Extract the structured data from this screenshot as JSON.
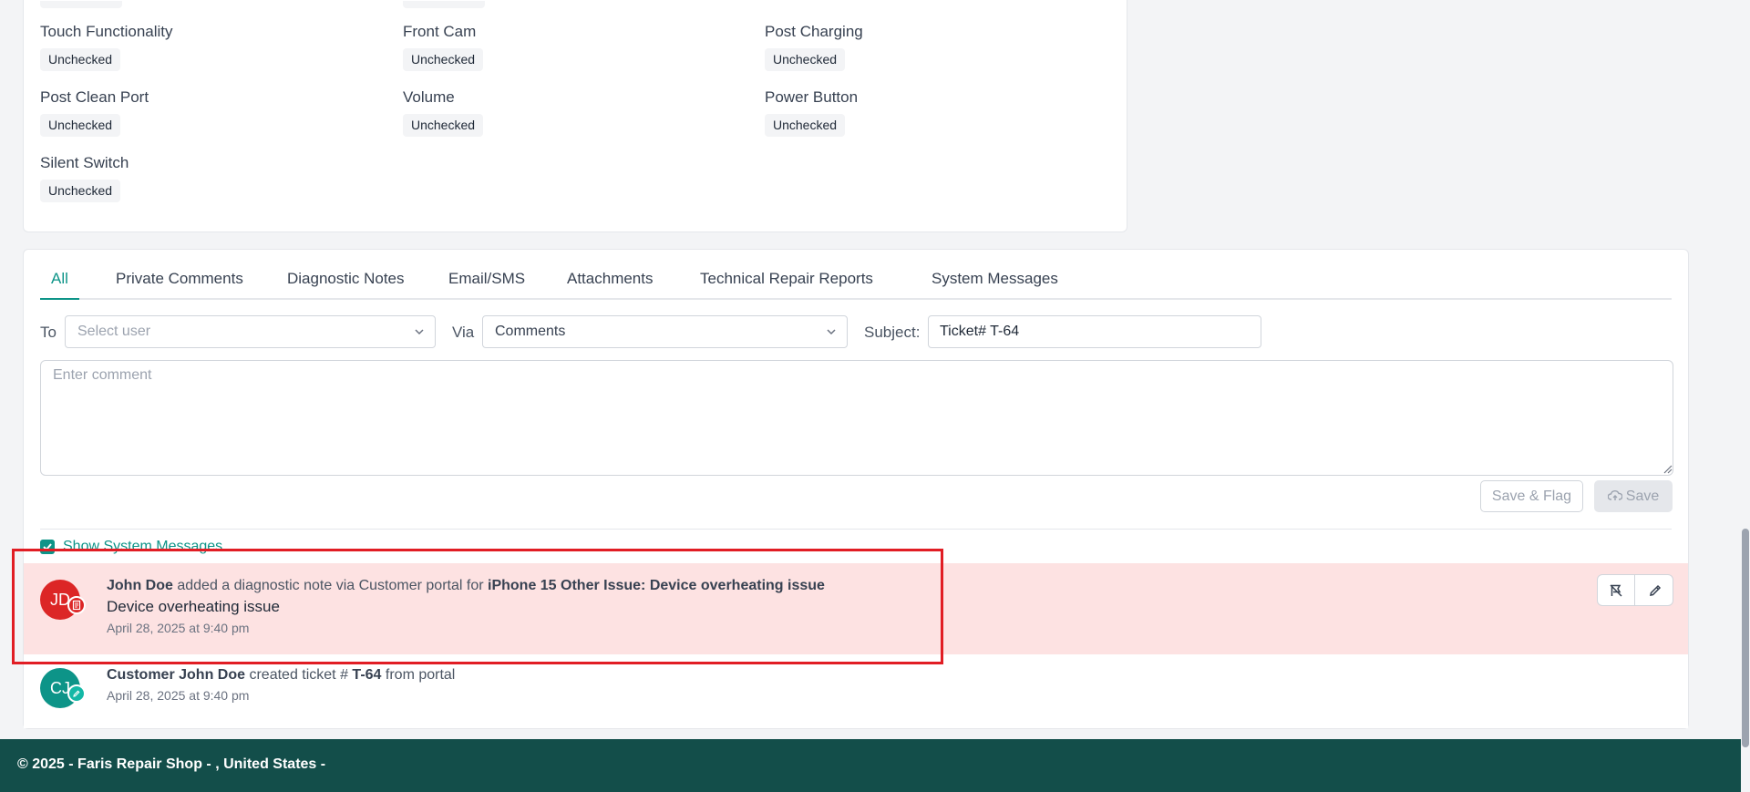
{
  "checklist": [
    {
      "label": "Touch Functionality",
      "status": "Unchecked"
    },
    {
      "label": "Front Cam",
      "status": "Unchecked"
    },
    {
      "label": "Post Charging",
      "status": "Unchecked"
    },
    {
      "label": "Post Clean Port",
      "status": "Unchecked"
    },
    {
      "label": "Volume",
      "status": "Unchecked"
    },
    {
      "label": "Power Button",
      "status": "Unchecked"
    },
    {
      "label": "Silent Switch",
      "status": "Unchecked"
    }
  ],
  "tabs": [
    "All",
    "Private Comments",
    "Diagnostic Notes",
    "Email/SMS",
    "Attachments",
    "Technical Repair Reports",
    "System Messages"
  ],
  "composer": {
    "to_label": "To",
    "to_placeholder": "Select user",
    "via_label": "Via",
    "via_value": "Comments",
    "subject_label": "Subject:",
    "subject_value": "Ticket# T-64",
    "comment_placeholder": "Enter comment",
    "save_flag_label": "Save & Flag",
    "save_label": "Save"
  },
  "show_system_messages": {
    "label": "Show System Messages",
    "checked": true
  },
  "messages": [
    {
      "initials": "JD",
      "author": "John Doe",
      "action": "added a diagnostic note via Customer portal for",
      "target": "iPhone 15 Other Issue: Device overheating issue",
      "body": "Device overheating issue",
      "time": "April 28, 2025 at 9:40 pm",
      "avatar_color": "#dc2626",
      "highlighted": true
    },
    {
      "initials": "CJ",
      "author": "Customer John Doe",
      "action_pre": "created ticket #",
      "ticket": "T-64",
      "action_post": "from portal",
      "time": "April 28, 2025 at 9:40 pm",
      "avatar_color": "#0d9488"
    }
  ],
  "footer": {
    "text": "© 2025 - Faris Repair Shop - , United States -"
  },
  "colors": {
    "accent": "#0d9488",
    "footer_bg": "#134e4a",
    "highlight_bg": "#fde2e2",
    "annotation_red": "#e11d24"
  }
}
